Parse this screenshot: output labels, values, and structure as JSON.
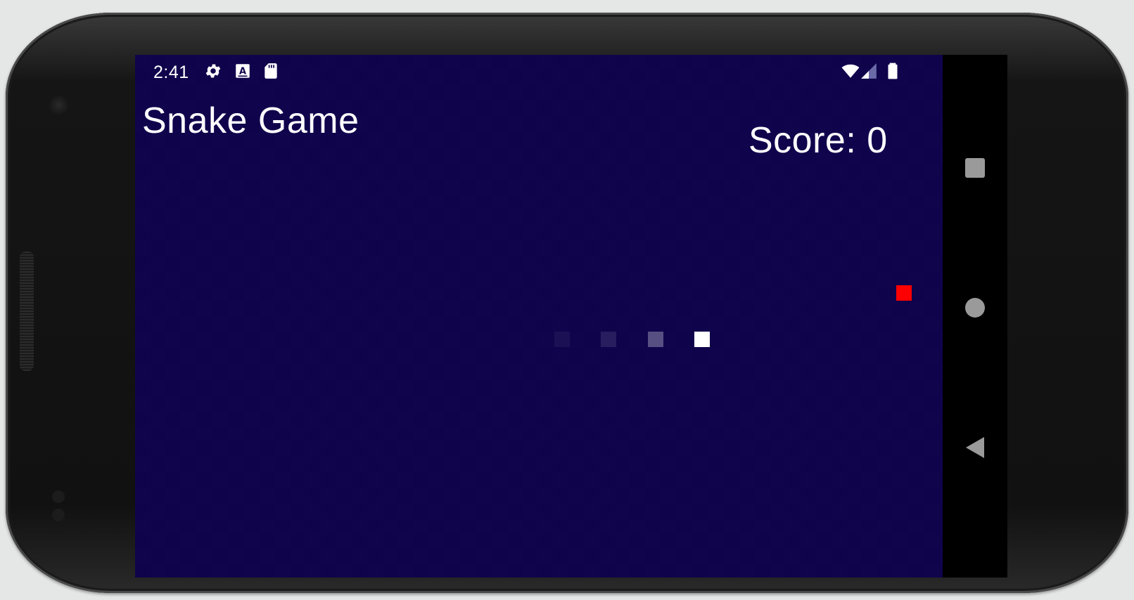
{
  "status_bar": {
    "time": "2:41",
    "icons": [
      "settings-icon",
      "keyboard-a-icon",
      "sd-card-icon",
      "wifi-icon",
      "signal-icon",
      "battery-icon"
    ]
  },
  "game": {
    "title": "Snake Game",
    "score_label": "Score: 0",
    "score": 0,
    "grid_columns": 52,
    "grid_rows": 34,
    "snake": [
      {
        "col": 36,
        "row": 18,
        "opacity": 1.0
      },
      {
        "col": 33,
        "row": 18,
        "opacity": 0.3
      },
      {
        "col": 30,
        "row": 18,
        "opacity": 0.1
      },
      {
        "col": 27,
        "row": 18,
        "opacity": 0.05
      }
    ],
    "food": {
      "col": 49,
      "row": 15
    },
    "colors": {
      "background": "#10044e",
      "snake": "#ffffff",
      "food": "#ff0000",
      "text": "#ffffff"
    }
  },
  "navigation": {
    "buttons": [
      "recents-button",
      "home-button",
      "back-button"
    ]
  }
}
